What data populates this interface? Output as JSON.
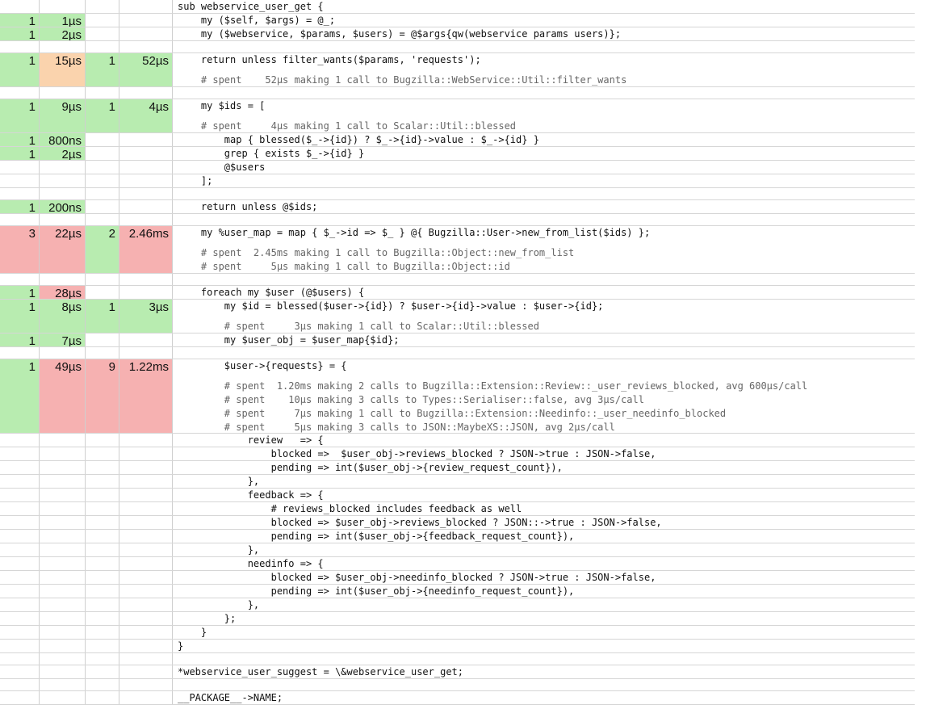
{
  "rows": [
    {
      "h": 17,
      "calls": "",
      "time": "",
      "sub_calls": "",
      "sub_time": "",
      "calls_color": "none",
      "time_color": "none",
      "sub_calls_color": "none",
      "sub_time_color": "none",
      "lines": [
        {
          "t": "sub webservice_user_get {",
          "c": false
        }
      ]
    },
    {
      "h": 17,
      "calls": "1",
      "time": "1µs",
      "sub_calls": "",
      "sub_time": "",
      "calls_color": "green",
      "time_color": "green",
      "sub_calls_color": "none",
      "sub_time_color": "none",
      "lines": [
        {
          "t": "    my ($self, $args) = @_;",
          "c": false
        }
      ]
    },
    {
      "h": 17,
      "calls": "1",
      "time": "2µs",
      "sub_calls": "",
      "sub_time": "",
      "calls_color": "green",
      "time_color": "green",
      "sub_calls_color": "none",
      "sub_time_color": "none",
      "lines": [
        {
          "t": "    my ($webservice, $params, $users) = @$args{qw(webservice params users)};",
          "c": false
        }
      ]
    },
    {
      "h": 15,
      "calls": "",
      "time": "",
      "sub_calls": "",
      "sub_time": "",
      "calls_color": "none",
      "time_color": "none",
      "sub_calls_color": "none",
      "sub_time_color": "none",
      "lines": []
    },
    {
      "h": 42,
      "calls": "1",
      "time": "15µs",
      "sub_calls": "1",
      "sub_time": "52µs",
      "calls_color": "green",
      "time_color": "orange",
      "sub_calls_color": "green",
      "sub_time_color": "green",
      "lines": [
        {
          "t": "    return unless filter_wants($params, 'requests');",
          "c": false
        },
        {
          "t": "    # spent    52µs making 1 call to Bugzilla::WebService::Util::filter_wants",
          "c": true
        }
      ]
    },
    {
      "h": 15,
      "calls": "",
      "time": "",
      "sub_calls": "",
      "sub_time": "",
      "calls_color": "none",
      "time_color": "none",
      "sub_calls_color": "none",
      "sub_time_color": "none",
      "lines": []
    },
    {
      "h": 42,
      "calls": "1",
      "time": "9µs",
      "sub_calls": "1",
      "sub_time": "4µs",
      "calls_color": "green",
      "time_color": "green",
      "sub_calls_color": "green",
      "sub_time_color": "green",
      "lines": [
        {
          "t": "    my $ids = [",
          "c": false
        },
        {
          "t": "    # spent     4µs making 1 call to Scalar::Util::blessed",
          "c": true
        }
      ]
    },
    {
      "h": 17,
      "calls": "1",
      "time": "800ns",
      "sub_calls": "",
      "sub_time": "",
      "calls_color": "green",
      "time_color": "green",
      "sub_calls_color": "none",
      "sub_time_color": "none",
      "lines": [
        {
          "t": "        map { blessed($_->{id}) ? $_->{id}->value : $_->{id} }",
          "c": false
        }
      ]
    },
    {
      "h": 17,
      "calls": "1",
      "time": "2µs",
      "sub_calls": "",
      "sub_time": "",
      "calls_color": "green",
      "time_color": "green",
      "sub_calls_color": "none",
      "sub_time_color": "none",
      "lines": [
        {
          "t": "        grep { exists $_->{id} }",
          "c": false
        }
      ]
    },
    {
      "h": 17,
      "calls": "",
      "time": "",
      "sub_calls": "",
      "sub_time": "",
      "calls_color": "none",
      "time_color": "none",
      "sub_calls_color": "none",
      "sub_time_color": "none",
      "lines": [
        {
          "t": "        @$users",
          "c": false
        }
      ]
    },
    {
      "h": 17,
      "calls": "",
      "time": "",
      "sub_calls": "",
      "sub_time": "",
      "calls_color": "none",
      "time_color": "none",
      "sub_calls_color": "none",
      "sub_time_color": "none",
      "lines": [
        {
          "t": "    ];",
          "c": false
        }
      ]
    },
    {
      "h": 15,
      "calls": "",
      "time": "",
      "sub_calls": "",
      "sub_time": "",
      "calls_color": "none",
      "time_color": "none",
      "sub_calls_color": "none",
      "sub_time_color": "none",
      "lines": []
    },
    {
      "h": 17,
      "calls": "1",
      "time": "200ns",
      "sub_calls": "",
      "sub_time": "",
      "calls_color": "green",
      "time_color": "green",
      "sub_calls_color": "none",
      "sub_time_color": "none",
      "lines": [
        {
          "t": "    return unless @$ids;",
          "c": false
        }
      ]
    },
    {
      "h": 15,
      "calls": "",
      "time": "",
      "sub_calls": "",
      "sub_time": "",
      "calls_color": "none",
      "time_color": "none",
      "sub_calls_color": "none",
      "sub_time_color": "none",
      "lines": []
    },
    {
      "h": 59,
      "calls": "3",
      "time": "22µs",
      "sub_calls": "2",
      "sub_time": "2.46ms",
      "calls_color": "red",
      "time_color": "red",
      "sub_calls_color": "green",
      "sub_time_color": "red",
      "lines": [
        {
          "t": "    my %user_map = map { $_->id => $_ } @{ Bugzilla::User->new_from_list($ids) };",
          "c": false
        },
        {
          "t": "    # spent  2.45ms making 1 call to Bugzilla::Object::new_from_list",
          "c": true
        },
        {
          "t": "    # spent     5µs making 1 call to Bugzilla::Object::id",
          "c": true
        }
      ]
    },
    {
      "h": 15,
      "calls": "",
      "time": "",
      "sub_calls": "",
      "sub_time": "",
      "calls_color": "none",
      "time_color": "none",
      "sub_calls_color": "none",
      "sub_time_color": "none",
      "lines": []
    },
    {
      "h": 17,
      "calls": "1",
      "time": "28µs",
      "sub_calls": "",
      "sub_time": "",
      "calls_color": "green",
      "time_color": "red",
      "sub_calls_color": "none",
      "sub_time_color": "none",
      "lines": [
        {
          "t": "    foreach my $user (@$users) {",
          "c": false
        }
      ]
    },
    {
      "h": 42,
      "calls": "1",
      "time": "8µs",
      "sub_calls": "1",
      "sub_time": "3µs",
      "calls_color": "green",
      "time_color": "green",
      "sub_calls_color": "green",
      "sub_time_color": "green",
      "lines": [
        {
          "t": "        my $id = blessed($user->{id}) ? $user->{id}->value : $user->{id};",
          "c": false
        },
        {
          "t": "        # spent     3µs making 1 call to Scalar::Util::blessed",
          "c": true
        }
      ]
    },
    {
      "h": 17,
      "calls": "1",
      "time": "7µs",
      "sub_calls": "",
      "sub_time": "",
      "calls_color": "green",
      "time_color": "green",
      "sub_calls_color": "none",
      "sub_time_color": "none",
      "lines": [
        {
          "t": "        my $user_obj = $user_map{$id};",
          "c": false
        }
      ]
    },
    {
      "h": 15,
      "calls": "",
      "time": "",
      "sub_calls": "",
      "sub_time": "",
      "calls_color": "none",
      "time_color": "none",
      "sub_calls_color": "none",
      "sub_time_color": "none",
      "lines": []
    },
    {
      "h": 92,
      "calls": "1",
      "time": "49µs",
      "sub_calls": "9",
      "sub_time": "1.22ms",
      "calls_color": "green",
      "time_color": "red",
      "sub_calls_color": "red",
      "sub_time_color": "red",
      "lines": [
        {
          "t": "        $user->{requests} = {",
          "c": false
        },
        {
          "t": "        # spent  1.20ms making 2 calls to Bugzilla::Extension::Review::_user_reviews_blocked, avg 600µs/call",
          "c": true
        },
        {
          "t": "        # spent    10µs making 3 calls to Types::Serialiser::false, avg 3µs/call",
          "c": true
        },
        {
          "t": "        # spent     7µs making 1 call to Bugzilla::Extension::Needinfo::_user_needinfo_blocked",
          "c": true
        },
        {
          "t": "        # spent     5µs making 3 calls to JSON::MaybeXS::JSON, avg 2µs/call",
          "c": true
        }
      ]
    },
    {
      "h": 17,
      "calls": "",
      "time": "",
      "sub_calls": "",
      "sub_time": "",
      "calls_color": "none",
      "time_color": "none",
      "sub_calls_color": "none",
      "sub_time_color": "none",
      "lines": [
        {
          "t": "            review   => {",
          "c": false
        }
      ]
    },
    {
      "h": 17,
      "calls": "",
      "time": "",
      "sub_calls": "",
      "sub_time": "",
      "calls_color": "none",
      "time_color": "none",
      "sub_calls_color": "none",
      "sub_time_color": "none",
      "lines": [
        {
          "t": "                blocked =>  $user_obj->reviews_blocked ? JSON->true : JSON->false,",
          "c": false
        }
      ]
    },
    {
      "h": 17,
      "calls": "",
      "time": "",
      "sub_calls": "",
      "sub_time": "",
      "calls_color": "none",
      "time_color": "none",
      "sub_calls_color": "none",
      "sub_time_color": "none",
      "lines": [
        {
          "t": "                pending => int($user_obj->{review_request_count}),",
          "c": false
        }
      ]
    },
    {
      "h": 17,
      "calls": "",
      "time": "",
      "sub_calls": "",
      "sub_time": "",
      "calls_color": "none",
      "time_color": "none",
      "sub_calls_color": "none",
      "sub_time_color": "none",
      "lines": [
        {
          "t": "            },",
          "c": false
        }
      ]
    },
    {
      "h": 17,
      "calls": "",
      "time": "",
      "sub_calls": "",
      "sub_time": "",
      "calls_color": "none",
      "time_color": "none",
      "sub_calls_color": "none",
      "sub_time_color": "none",
      "lines": [
        {
          "t": "            feedback => {",
          "c": false
        }
      ]
    },
    {
      "h": 17,
      "calls": "",
      "time": "",
      "sub_calls": "",
      "sub_time": "",
      "calls_color": "none",
      "time_color": "none",
      "sub_calls_color": "none",
      "sub_time_color": "none",
      "lines": [
        {
          "t": "                # reviews_blocked includes feedback as well",
          "c": false
        }
      ]
    },
    {
      "h": 17,
      "calls": "",
      "time": "",
      "sub_calls": "",
      "sub_time": "",
      "calls_color": "none",
      "time_color": "none",
      "sub_calls_color": "none",
      "sub_time_color": "none",
      "lines": [
        {
          "t": "                blocked => $user_obj->reviews_blocked ? JSON::->true : JSON->false,",
          "c": false
        }
      ]
    },
    {
      "h": 17,
      "calls": "",
      "time": "",
      "sub_calls": "",
      "sub_time": "",
      "calls_color": "none",
      "time_color": "none",
      "sub_calls_color": "none",
      "sub_time_color": "none",
      "lines": [
        {
          "t": "                pending => int($user_obj->{feedback_request_count}),",
          "c": false
        }
      ]
    },
    {
      "h": 17,
      "calls": "",
      "time": "",
      "sub_calls": "",
      "sub_time": "",
      "calls_color": "none",
      "time_color": "none",
      "sub_calls_color": "none",
      "sub_time_color": "none",
      "lines": [
        {
          "t": "            },",
          "c": false
        }
      ]
    },
    {
      "h": 17,
      "calls": "",
      "time": "",
      "sub_calls": "",
      "sub_time": "",
      "calls_color": "none",
      "time_color": "none",
      "sub_calls_color": "none",
      "sub_time_color": "none",
      "lines": [
        {
          "t": "            needinfo => {",
          "c": false
        }
      ]
    },
    {
      "h": 17,
      "calls": "",
      "time": "",
      "sub_calls": "",
      "sub_time": "",
      "calls_color": "none",
      "time_color": "none",
      "sub_calls_color": "none",
      "sub_time_color": "none",
      "lines": [
        {
          "t": "                blocked => $user_obj->needinfo_blocked ? JSON->true : JSON->false,",
          "c": false
        }
      ]
    },
    {
      "h": 17,
      "calls": "",
      "time": "",
      "sub_calls": "",
      "sub_time": "",
      "calls_color": "none",
      "time_color": "none",
      "sub_calls_color": "none",
      "sub_time_color": "none",
      "lines": [
        {
          "t": "                pending => int($user_obj->{needinfo_request_count}),",
          "c": false
        }
      ]
    },
    {
      "h": 17,
      "calls": "",
      "time": "",
      "sub_calls": "",
      "sub_time": "",
      "calls_color": "none",
      "time_color": "none",
      "sub_calls_color": "none",
      "sub_time_color": "none",
      "lines": [
        {
          "t": "            },",
          "c": false
        }
      ]
    },
    {
      "h": 17,
      "calls": "",
      "time": "",
      "sub_calls": "",
      "sub_time": "",
      "calls_color": "none",
      "time_color": "none",
      "sub_calls_color": "none",
      "sub_time_color": "none",
      "lines": [
        {
          "t": "        };",
          "c": false
        }
      ]
    },
    {
      "h": 17,
      "calls": "",
      "time": "",
      "sub_calls": "",
      "sub_time": "",
      "calls_color": "none",
      "time_color": "none",
      "sub_calls_color": "none",
      "sub_time_color": "none",
      "lines": [
        {
          "t": "    }",
          "c": false
        }
      ]
    },
    {
      "h": 17,
      "calls": "",
      "time": "",
      "sub_calls": "",
      "sub_time": "",
      "calls_color": "none",
      "time_color": "none",
      "sub_calls_color": "none",
      "sub_time_color": "none",
      "lines": [
        {
          "t": "}",
          "c": false
        }
      ]
    },
    {
      "h": 15,
      "calls": "",
      "time": "",
      "sub_calls": "",
      "sub_time": "",
      "calls_color": "none",
      "time_color": "none",
      "sub_calls_color": "none",
      "sub_time_color": "none",
      "lines": []
    },
    {
      "h": 17,
      "calls": "",
      "time": "",
      "sub_calls": "",
      "sub_time": "",
      "calls_color": "none",
      "time_color": "none",
      "sub_calls_color": "none",
      "sub_time_color": "none",
      "lines": [
        {
          "t": "*webservice_user_suggest = \\&webservice_user_get;",
          "c": false
        }
      ]
    },
    {
      "h": 15,
      "calls": "",
      "time": "",
      "sub_calls": "",
      "sub_time": "",
      "calls_color": "none",
      "time_color": "none",
      "sub_calls_color": "none",
      "sub_time_color": "none",
      "lines": []
    },
    {
      "h": 17,
      "calls": "",
      "time": "",
      "sub_calls": "",
      "sub_time": "",
      "calls_color": "none",
      "time_color": "none",
      "sub_calls_color": "none",
      "sub_time_color": "none",
      "lines": [
        {
          "t": "__PACKAGE__->NAME;",
          "c": false
        }
      ]
    }
  ]
}
